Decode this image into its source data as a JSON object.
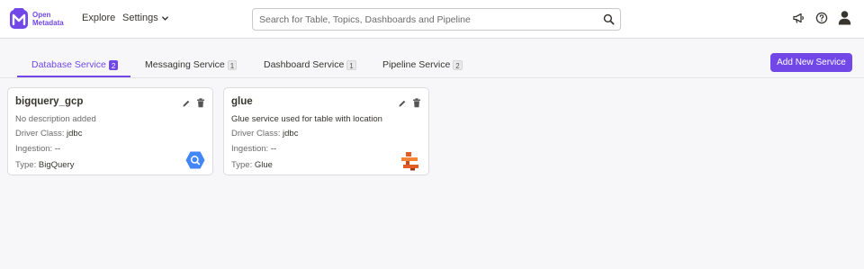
{
  "header": {
    "logo_line1": "Open",
    "logo_line2": "Metadata",
    "nav": {
      "explore": "Explore",
      "settings": "Settings"
    },
    "search": {
      "placeholder": "Search for Table, Topics, Dashboards and Pipeline",
      "value": ""
    }
  },
  "tabs": [
    {
      "label": "Database Service",
      "count": "2",
      "active": true
    },
    {
      "label": "Messaging Service",
      "count": "1",
      "active": false
    },
    {
      "label": "Dashboard Service",
      "count": "1",
      "active": false
    },
    {
      "label": "Pipeline Service",
      "count": "2",
      "active": false
    }
  ],
  "actions": {
    "add_service": "Add New Service"
  },
  "cards": [
    {
      "title": "bigquery_gcp",
      "description": "No description added",
      "driver_label": "Driver Class:",
      "driver_value": "jdbc",
      "ingestion_label": "Ingestion:",
      "ingestion_value": "--",
      "type_label": "Type:",
      "type_value": "BigQuery",
      "logo": "bigquery-logo"
    },
    {
      "title": "glue",
      "description": "Glue service used for table with location",
      "driver_label": "Driver Class:",
      "driver_value": "jdbc",
      "ingestion_label": "Ingestion:",
      "ingestion_value": "--",
      "type_label": "Type:",
      "type_value": "Glue",
      "logo": "aws-glue-logo"
    }
  ],
  "colors": {
    "accent": "#7147e8",
    "bigquery": "#4386fa",
    "glue": "#e25d26"
  }
}
